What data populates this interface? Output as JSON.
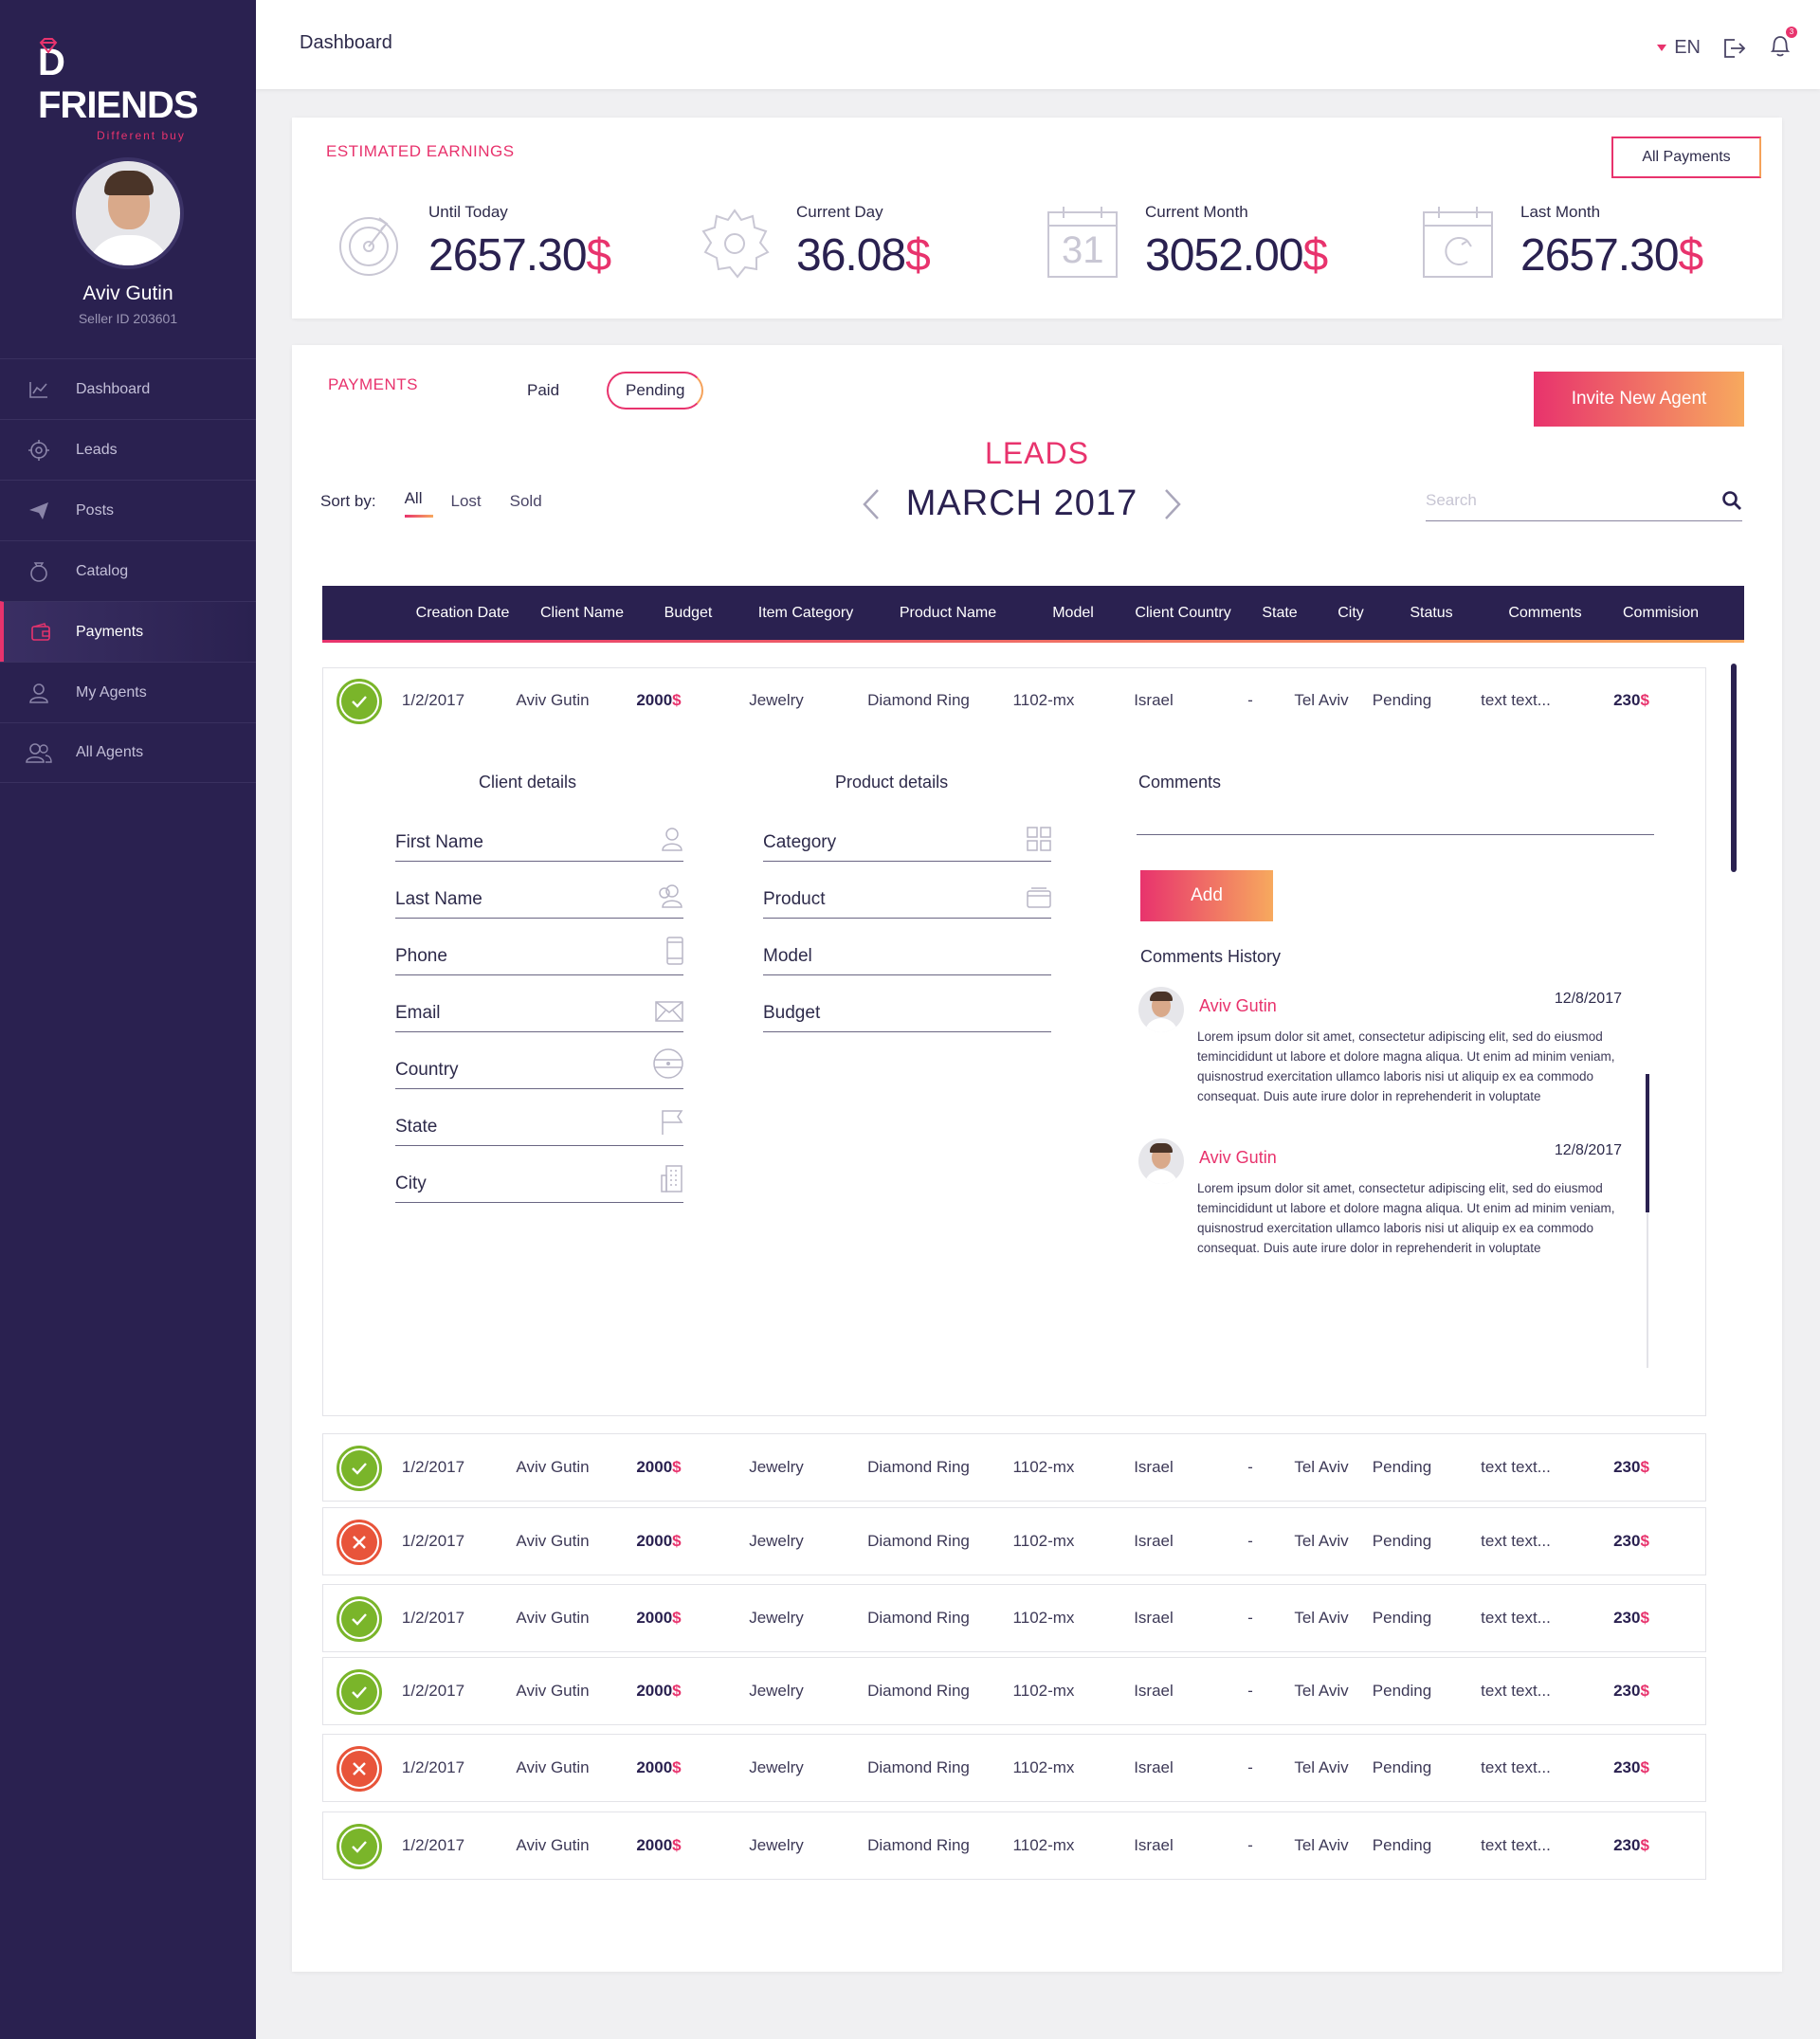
{
  "brand": {
    "name": "D FRIENDS",
    "tagline": "Different buy",
    "accent": "#e8336d",
    "secondary": "#f7a95e",
    "dark": "#2a2150"
  },
  "profile": {
    "name": "Aviv Gutin",
    "seller_id": "Seller ID 203601"
  },
  "nav": [
    {
      "label": "Dashboard",
      "icon": "chart-icon"
    },
    {
      "label": "Leads",
      "icon": "target-icon"
    },
    {
      "label": "Posts",
      "icon": "paper-plane-icon"
    },
    {
      "label": "Catalog",
      "icon": "ring-icon"
    },
    {
      "label": "Payments",
      "icon": "wallet-icon",
      "active": true
    },
    {
      "label": "My Agents",
      "icon": "user-icon"
    },
    {
      "label": "All Agents",
      "icon": "users-icon"
    }
  ],
  "topbar": {
    "title": "Dashboard",
    "language": "EN",
    "notifications": "3"
  },
  "earnings": {
    "title": "ESTIMATED EARNINGS",
    "all_payments": "All Payments",
    "currency": "$",
    "stats": [
      {
        "label": "Until Today",
        "value": "2657.30",
        "icon": "dial-icon"
      },
      {
        "label": "Current Day",
        "value": "36.08",
        "icon": "sun-icon"
      },
      {
        "label": "Current Month",
        "value": "3052.00",
        "icon": "calendar-icon",
        "day": "31"
      },
      {
        "label": "Last Month",
        "value": "2657.30",
        "icon": "calendar-return-icon"
      }
    ]
  },
  "payments": {
    "title": "PAYMENTS",
    "tab_paid": "Paid",
    "tab_pending": "Pending",
    "invite": "Invite New Agent",
    "leads_title": "LEADS",
    "month": "MARCH 2017",
    "sort_label": "Sort by:",
    "sort_all": "All",
    "sort_lost": "Lost",
    "sort_sold": "Sold",
    "search_placeholder": "Search"
  },
  "table": {
    "headers": [
      "Creation Date",
      "Client Name",
      "Budget",
      "Item Category",
      "Product Name",
      "Model",
      "Client Country",
      "State",
      "City",
      "Status",
      "Comments",
      "Commision"
    ],
    "rows": [
      {
        "status": "ok",
        "date": "1/2/2017",
        "client": "Aviv Gutin",
        "budget": "2000",
        "category": "Jewelry",
        "product": "Diamond Ring",
        "model": "1102-mx",
        "country": "Israel",
        "state": "-",
        "city": "Tel Aviv",
        "status_text": "Pending",
        "comments": "text text...",
        "commission": "230"
      },
      {
        "status": "ok",
        "date": "1/2/2017",
        "client": "Aviv Gutin",
        "budget": "2000",
        "category": "Jewelry",
        "product": "Diamond Ring",
        "model": "1102-mx",
        "country": "Israel",
        "state": "-",
        "city": "Tel Aviv",
        "status_text": "Pending",
        "comments": "text text...",
        "commission": "230"
      },
      {
        "status": "bad",
        "date": "1/2/2017",
        "client": "Aviv Gutin",
        "budget": "2000",
        "category": "Jewelry",
        "product": "Diamond Ring",
        "model": "1102-mx",
        "country": "Israel",
        "state": "-",
        "city": "Tel Aviv",
        "status_text": "Pending",
        "comments": "text text...",
        "commission": "230"
      },
      {
        "status": "ok",
        "date": "1/2/2017",
        "client": "Aviv Gutin",
        "budget": "2000",
        "category": "Jewelry",
        "product": "Diamond Ring",
        "model": "1102-mx",
        "country": "Israel",
        "state": "-",
        "city": "Tel Aviv",
        "status_text": "Pending",
        "comments": "text text...",
        "commission": "230"
      },
      {
        "status": "ok",
        "date": "1/2/2017",
        "client": "Aviv Gutin",
        "budget": "2000",
        "category": "Jewelry",
        "product": "Diamond Ring",
        "model": "1102-mx",
        "country": "Israel",
        "state": "-",
        "city": "Tel Aviv",
        "status_text": "Pending",
        "comments": "text text...",
        "commission": "230"
      },
      {
        "status": "bad",
        "date": "1/2/2017",
        "client": "Aviv Gutin",
        "budget": "2000",
        "category": "Jewelry",
        "product": "Diamond Ring",
        "model": "1102-mx",
        "country": "Israel",
        "state": "-",
        "city": "Tel Aviv",
        "status_text": "Pending",
        "comments": "text text...",
        "commission": "230"
      },
      {
        "status": "ok",
        "date": "1/2/2017",
        "client": "Aviv Gutin",
        "budget": "2000",
        "category": "Jewelry",
        "product": "Diamond Ring",
        "model": "1102-mx",
        "country": "Israel",
        "state": "-",
        "city": "Tel Aviv",
        "status_text": "Pending",
        "comments": "text text...",
        "commission": "230"
      }
    ]
  },
  "details": {
    "client_title": "Client details",
    "product_title": "Product details",
    "comments_title": "Comments",
    "client_fields": [
      "First Name",
      "Last Name",
      "Phone",
      "Email",
      "Country",
      "State",
      "City"
    ],
    "product_fields": [
      "Category",
      "Product",
      "Model",
      "Budget"
    ],
    "add": "Add",
    "history_title": "Comments History",
    "history": [
      {
        "name": "Aviv Gutin",
        "date": "12/8/2017",
        "text": "Lorem ipsum dolor sit amet, consectetur adipiscing elit, sed do eiusmod temincididunt ut labore et dolore magna aliqua. Ut enim ad minim veniam, quisnostrud exercitation ullamco laboris nisi ut aliquip ex ea commodo consequat. Duis aute irure dolor in reprehenderit in voluptate"
      },
      {
        "name": "Aviv Gutin",
        "date": "12/8/2017",
        "text": "Lorem ipsum dolor sit amet, consectetur adipiscing elit, sed do eiusmod temincididunt ut labore et dolore magna aliqua. Ut enim ad minim veniam, quisnostrud exercitation ullamco laboris nisi ut aliquip ex ea commodo consequat. Duis aute irure dolor in reprehenderit in voluptate"
      }
    ]
  }
}
